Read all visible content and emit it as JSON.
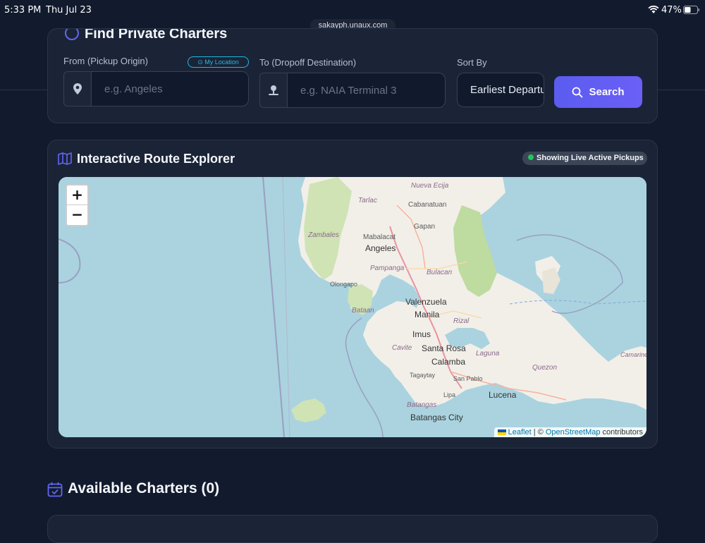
{
  "status_bar": {
    "time": "5:33 PM",
    "date": "Thu Jul 23",
    "battery": "47%"
  },
  "browser": {
    "url": "sakayph.unaux.com"
  },
  "search_panel": {
    "title": "Find Private Charters",
    "from_label": "From (Pickup Origin)",
    "from_placeholder": "e.g. Angeles",
    "my_location_label": "My Location",
    "to_label": "To (Dropoff Destination)",
    "to_placeholder": "e.g. NAIA Terminal 3",
    "sort_label": "Sort By",
    "sort_value": "Earliest Departure",
    "search_button": "Search"
  },
  "explorer": {
    "title": "Interactive Route Explorer",
    "live_badge": "Showing Live Active Pickups",
    "zoom_in": "+",
    "zoom_out": "−",
    "attribution": {
      "leaflet": "Leaflet",
      "sep": " | © ",
      "osm": "OpenStreetMap",
      "tail": " contributors"
    },
    "places": {
      "nueva_ecija": "Nueva Ecija",
      "tarlac": "Tarlac",
      "cabanatuan": "Cabanatuan",
      "zambales": "Zambales",
      "mabalacat": "Mabalacat",
      "gapan": "Gapan",
      "angeles": "Angeles",
      "pampanga": "Pampanga",
      "bulacan": "Bulacan",
      "olongapo": "Olongapo",
      "bataan": "Bataan",
      "valenzuela": "Valenzuela",
      "manila": "Manila",
      "rizal": "Rizal",
      "imus": "Imus",
      "cavite": "Cavite",
      "santa_rosa": "Santa Rosa",
      "laguna": "Laguna",
      "calamba": "Calamba",
      "quezon": "Quezon",
      "camarines_norte": "Camarines Norte",
      "tagaytay": "Tagaytay",
      "san_pablo": "San Pablo",
      "lipa": "Lipa",
      "lucena": "Lucena",
      "batangas": "Batangas",
      "batangas_city": "Batangas City"
    }
  },
  "charters": {
    "title": "Available Charters (0)"
  },
  "colors": {
    "accent": "#6366f1",
    "background": "#121b2d",
    "card": "#1b2437",
    "live": "#22c55e",
    "link": "#22b8e0"
  }
}
